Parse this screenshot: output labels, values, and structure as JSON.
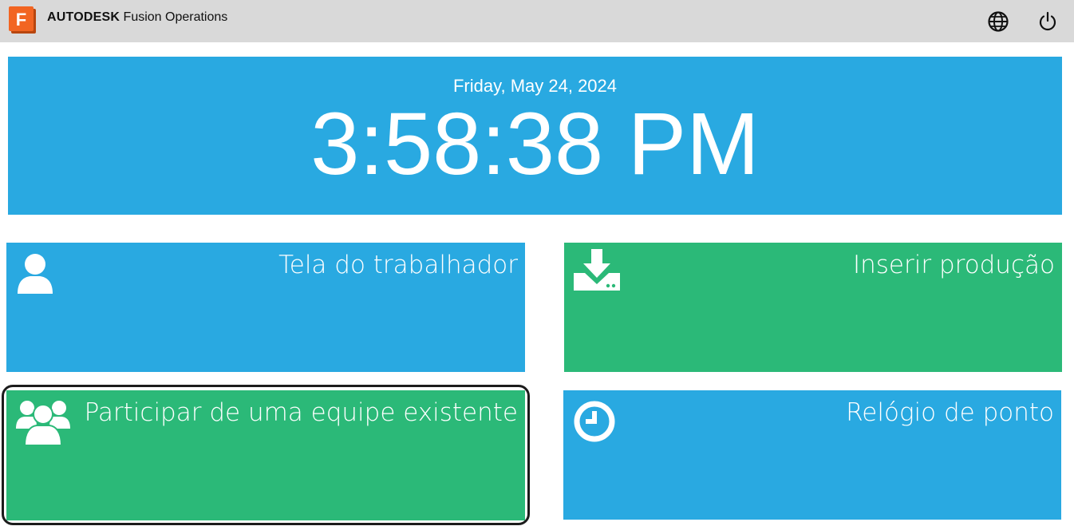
{
  "header": {
    "brand_bold": "AUTODESK",
    "brand_rest": " Fusion Operations",
    "logo_letter": "F",
    "logo_color": "#f26522",
    "globe_icon": "globe-icon",
    "power_icon": "power-icon"
  },
  "clock": {
    "date": "Friday, May 24, 2024",
    "time": "3:58:38 PM"
  },
  "tiles": [
    {
      "label": "Tela do trabalhador",
      "icon": "user-icon",
      "color": "#29a9e1"
    },
    {
      "label": "Inserir produção",
      "icon": "download-tray-icon",
      "color": "#2bb978"
    },
    {
      "label": "Participar de uma equipe existente",
      "icon": "users-group-icon",
      "color": "#2bb978"
    },
    {
      "label": "Relógio de ponto",
      "icon": "clock-icon",
      "color": "#29a9e1"
    }
  ]
}
